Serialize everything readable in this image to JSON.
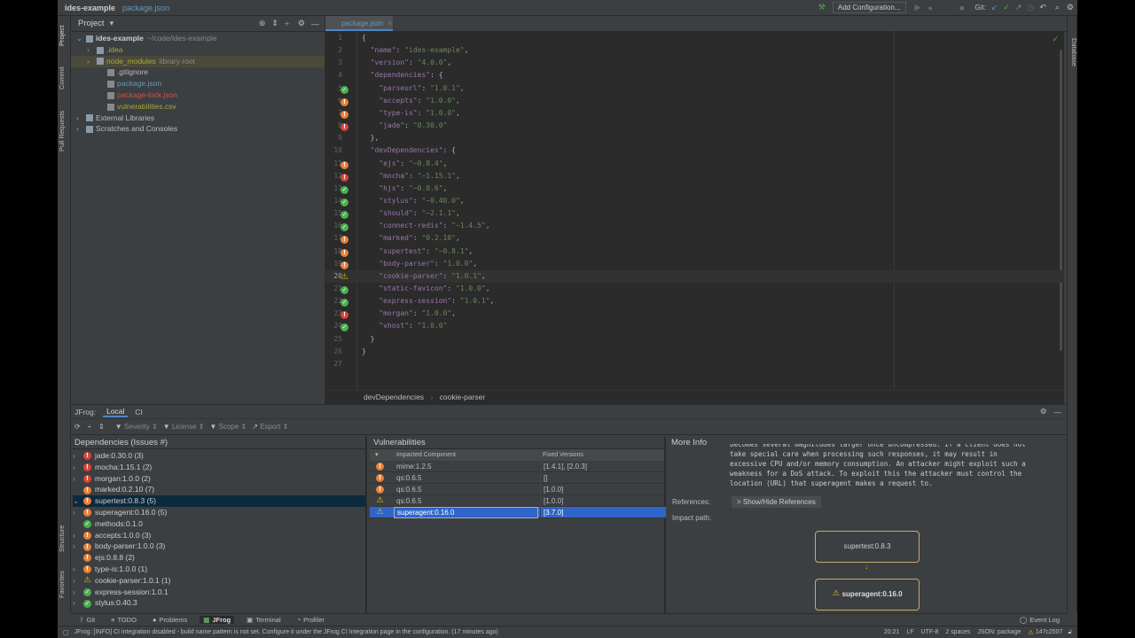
{
  "titlebar": {
    "project": "ides-example",
    "file": "package.json",
    "add_config": "Add Configuration...",
    "git_label": "Git:"
  },
  "left_strip": [
    "Project",
    "Commit",
    "Pull Requests",
    "Structure",
    "Favorites"
  ],
  "right_strip": [
    "Database"
  ],
  "project_panel": {
    "title": "Project",
    "tree": [
      {
        "label": "ides-example",
        "extra": "~/code/ides-example",
        "depth": 0,
        "arrow": "v",
        "color": "#ccc",
        "bold": true
      },
      {
        "label": ".idea",
        "depth": 1,
        "arrow": ">",
        "color": "#a8a83a"
      },
      {
        "label": "node_modules",
        "extra": "library root",
        "depth": 1,
        "arrow": ">",
        "color": "#a8a83a",
        "selected": true
      },
      {
        "label": ".gitignore",
        "depth": 2,
        "color": "#bbb"
      },
      {
        "label": "package.json",
        "depth": 2,
        "color": "#6897bb"
      },
      {
        "label": "package-lock.json",
        "depth": 2,
        "color": "#c75450"
      },
      {
        "label": "vulnerabilities.csv",
        "depth": 2,
        "color": "#a8a83a"
      },
      {
        "label": "External Libraries",
        "depth": 0,
        "arrow": ">",
        "color": "#bbb"
      },
      {
        "label": "Scratches and Consoles",
        "depth": 0,
        "arrow": ">",
        "color": "#bbb"
      }
    ]
  },
  "editor": {
    "tab": "package.json",
    "breadcrumb": [
      "devDependencies",
      "cookie-parser"
    ],
    "lines": [
      {
        "t": "{"
      },
      {
        "k": "name",
        "v": "ides-example",
        "i": 1
      },
      {
        "k": "version",
        "v": "4.0.0",
        "i": 1
      },
      {
        "k": "dependencies",
        "o": "{",
        "i": 1
      },
      {
        "k": "parseurl",
        "v": "1.0.1",
        "i": 2,
        "s": "ok"
      },
      {
        "k": "accepts",
        "v": "1.0.0",
        "i": 2,
        "s": "high"
      },
      {
        "k": "type-is",
        "v": "1.0.0",
        "i": 2,
        "s": "high"
      },
      {
        "k": "jade",
        "v": "0.30.0",
        "i": 2,
        "s": "crit",
        "last": true
      },
      {
        "t": "},",
        "i": 1
      },
      {
        "k": "devDependencies",
        "o": "{",
        "i": 1
      },
      {
        "k": "ejs",
        "v": "~0.8.4",
        "i": 2,
        "s": "high"
      },
      {
        "k": "mocha",
        "v": "~1.15.1",
        "i": 2,
        "s": "crit"
      },
      {
        "k": "hjs",
        "v": "~0.0.6",
        "i": 2,
        "s": "ok"
      },
      {
        "k": "stylus",
        "v": "~0.40.0",
        "i": 2,
        "s": "ok"
      },
      {
        "k": "should",
        "v": "~2.1.1",
        "i": 2,
        "s": "ok"
      },
      {
        "k": "connect-redis",
        "v": "~1.4.5",
        "i": 2,
        "s": "ok"
      },
      {
        "k": "marked",
        "v": "0.2.10",
        "i": 2,
        "s": "high"
      },
      {
        "k": "supertest",
        "v": "~0.8.1",
        "i": 2,
        "s": "high"
      },
      {
        "k": "body-parser",
        "v": "1.0.0",
        "i": 2,
        "s": "high"
      },
      {
        "k": "cookie-parser",
        "v": "1.0.1",
        "i": 2,
        "s": "warn"
      },
      {
        "k": "static-favicon",
        "v": "1.0.0",
        "i": 2,
        "s": "ok"
      },
      {
        "k": "express-session",
        "v": "1.0.1",
        "i": 2,
        "s": "ok"
      },
      {
        "k": "morgan",
        "v": "1.0.0",
        "i": 2,
        "s": "crit"
      },
      {
        "k": "vhost",
        "v": "1.0.0",
        "i": 2,
        "s": "ok",
        "last": true
      },
      {
        "t": "}",
        "i": 1
      },
      {
        "t": "}"
      },
      {
        "t": ""
      }
    ]
  },
  "jfrog": {
    "label": "JFrog:",
    "tabs": [
      "Local",
      "CI"
    ],
    "filters": [
      "Severity",
      "License",
      "Scope",
      "Export"
    ],
    "deps_title": "Dependencies (Issues #)",
    "deps": [
      {
        "label": "jade:0.30.0 (3)",
        "s": "crit",
        "arrow": ">",
        "d": 0
      },
      {
        "label": "mocha:1.15.1 (2)",
        "s": "crit",
        "arrow": ">",
        "d": 0
      },
      {
        "label": "morgan:1.0.0 (2)",
        "s": "crit",
        "arrow": ">",
        "d": 0
      },
      {
        "label": "marked:0.2.10 (7)",
        "s": "high",
        "d": 0
      },
      {
        "label": "supertest:0.8.3 (5)",
        "s": "high",
        "arrow": "v",
        "d": 0,
        "selected": true
      },
      {
        "label": "superagent:0.16.0 (5)",
        "s": "high",
        "arrow": ">",
        "d": 1
      },
      {
        "label": "methods:0.1.0",
        "s": "ok",
        "d": 1
      },
      {
        "label": "accepts:1.0.0 (3)",
        "s": "high",
        "arrow": ">",
        "d": 0
      },
      {
        "label": "body-parser:1.0.0 (3)",
        "s": "high",
        "arrow": ">",
        "d": 0
      },
      {
        "label": "ejs:0.8.8 (2)",
        "s": "high",
        "d": 0
      },
      {
        "label": "type-is:1.0.0 (1)",
        "s": "high",
        "arrow": ">",
        "d": 0
      },
      {
        "label": "cookie-parser:1.0.1 (1)",
        "s": "warn",
        "arrow": ">",
        "d": 0
      },
      {
        "label": "express-session:1.0.1",
        "s": "ok",
        "arrow": ">",
        "d": 0
      },
      {
        "label": "stylus:0.40.3",
        "s": "ok",
        "arrow": ">",
        "d": 0
      }
    ],
    "vulns_title": "Vulnerabilities",
    "vuln_cols": [
      "Impacted Component",
      "Fixed Versions"
    ],
    "vulns": [
      {
        "s": "high",
        "c": "mime:1.2.5",
        "f": "[1.4.1], [2.0.3]"
      },
      {
        "s": "high",
        "c": "qs:0.6.5",
        "f": "[]"
      },
      {
        "s": "high",
        "c": "qs:0.6.5",
        "f": "[1.0.0]"
      },
      {
        "s": "warn",
        "c": "qs:0.6.5",
        "f": "[1.0.0]"
      },
      {
        "s": "warn",
        "c": "superagent:0.16.0",
        "f": "[3.7.0]",
        "selected": true
      }
    ],
    "info_title": "More Info",
    "info_text": "becomes several magnitudes larger once uncompressed. If a client does not\ntake special care when processing such responses, it may result in\nexcessive CPU and/or memory consumption. An attacker might exploit such a\nweakness for a DoS attack. To exploit this the attacker must control the\nlocation (URL) that superagent makes a request to.",
    "references_label": "References:",
    "references_btn": "> Show/Hide References",
    "impact_label": "Impact path:",
    "impact_path": [
      "supertest:0.8.3",
      "superagent:0.16.0"
    ]
  },
  "toolwindows": [
    "Git",
    "TODO",
    "Problems",
    "JFrog",
    "Terminal",
    "Profiler"
  ],
  "event_log": "Event Log",
  "status": {
    "message": "JFrog: [INFO] CI integration disabled - build name pattern is not set. Configure it under the JFrog CI Integration page in the configuration. (17 minutes ago)",
    "items": [
      "20:21",
      "LF",
      "UTF-8",
      "2 spaces",
      "JSON: package",
      "147c2507"
    ]
  },
  "colors": {
    "high": "#e8803a",
    "critical": "#d9433a",
    "ok": "#4caf50",
    "warn": "#f0c000",
    "selection": "#2f65ca"
  }
}
